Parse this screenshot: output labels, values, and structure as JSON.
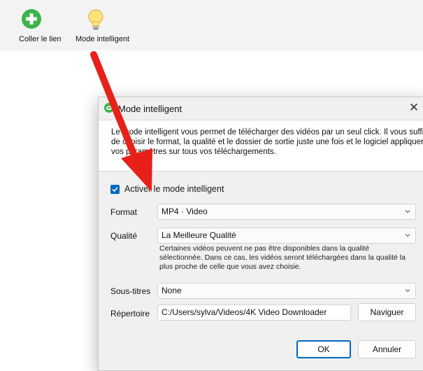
{
  "toolbar": {
    "paste_label": "Coller le lien",
    "smart_mode_label": "Mode intelligent"
  },
  "dialog": {
    "title": "Mode intelligent",
    "close_glyph": "✕",
    "description": "Le mode intelligent vous permet de télécharger des vidéos par un seul click. Il vous suffit de choisir le format, la qualité et le dossier de sortie juste une fois et le logiciel appliquera vos paramètres sur tous vos téléchargements.",
    "enable_checkbox": {
      "label": "Activer le mode intelligent",
      "checked": true
    },
    "format": {
      "label": "Format",
      "value": "MP4 · Video"
    },
    "quality": {
      "label": "Qualité",
      "value": "La Meilleure Qualité",
      "note": "Certaines vidéos peuvent ne pas être disponibles dans la qualité sélectionnée. Dans ce cas, les vidéos seront téléchargées dans la qualité la plus proche de celle que vous avez choisie."
    },
    "subtitles": {
      "label": "Sous-titres",
      "value": "None"
    },
    "directory": {
      "label": "Répertoire",
      "value": "C:/Users/sylva/Videos/4K Video Downloader"
    },
    "browse_label": "Naviguer",
    "ok_label": "OK",
    "cancel_label": "Annuler"
  },
  "colors": {
    "accent": "#0067c0",
    "annotation_arrow": "#e8201a",
    "paste_icon": "#3bb54a",
    "bulb": "#ffe27a"
  },
  "icons": [
    "plus-circle-icon",
    "lightbulb-icon",
    "app-logo-icon",
    "close-icon",
    "checkmark-icon",
    "chevron-down-icon"
  ]
}
